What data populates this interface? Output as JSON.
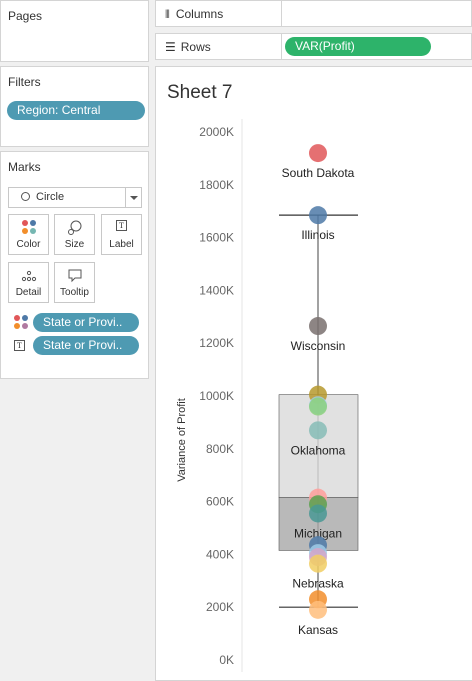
{
  "pages": {
    "title": "Pages"
  },
  "filters": {
    "title": "Filters",
    "pills": [
      "Region: Central"
    ]
  },
  "marks": {
    "title": "Marks",
    "mark_type": "Circle",
    "buttons": {
      "color": "Color",
      "size": "Size",
      "label": "Label",
      "detail": "Detail",
      "tooltip": "Tooltip"
    },
    "fields": {
      "color_field": "State or Provi..",
      "label_field": "State or Provi.."
    }
  },
  "shelves": {
    "columns_label": "Columns",
    "rows_label": "Rows",
    "rows_pill": "VAR(Profit)"
  },
  "sheet": {
    "title": "Sheet 7"
  },
  "chart_data": {
    "type": "scatter",
    "ylabel": "Variance of Profit",
    "ylim": [
      0,
      2000000
    ],
    "ytick_values": [
      0,
      200000,
      400000,
      600000,
      800000,
      1000000,
      1200000,
      1400000,
      1600000,
      1800000,
      2000000
    ],
    "ytick_labels": [
      "0K",
      "200K",
      "400K",
      "600K",
      "800K",
      "1000K",
      "1200K",
      "1400K",
      "1600K",
      "1800K",
      "2000K"
    ],
    "points": [
      {
        "label": "South Dakota",
        "y": 1920000,
        "color": "#e15759",
        "show_label": true
      },
      {
        "label": "Illinois",
        "y": 1685000,
        "color": "#4e79a7",
        "show_label": true
      },
      {
        "label": "Wisconsin",
        "y": 1265000,
        "color": "#79706e",
        "show_label": true
      },
      {
        "label": "",
        "y": 1005000,
        "color": "#b6992d",
        "show_label": false
      },
      {
        "label": "",
        "y": 965000,
        "color": "#a0cbe8",
        "show_label": false
      },
      {
        "label": "",
        "y": 960000,
        "color": "#8cd17d",
        "show_label": false
      },
      {
        "label": "Oklahoma",
        "y": 870000,
        "color": "#86bcb6",
        "show_label": true
      },
      {
        "label": "",
        "y": 615000,
        "color": "#ff9d9a",
        "show_label": false
      },
      {
        "label": "",
        "y": 590000,
        "color": "#59a14f",
        "show_label": false
      },
      {
        "label": "Michigan",
        "y": 555000,
        "color": "#499894",
        "show_label": true
      },
      {
        "label": "",
        "y": 435000,
        "color": "#4e79a7",
        "show_label": false
      },
      {
        "label": "",
        "y": 405000,
        "color": "#a0cbe8",
        "show_label": false
      },
      {
        "label": "",
        "y": 390000,
        "color": "#d4a6c8",
        "show_label": false
      },
      {
        "label": "Nebraska",
        "y": 365000,
        "color": "#f1ce63",
        "show_label": true
      },
      {
        "label": "",
        "y": 230000,
        "color": "#f28e2b",
        "show_label": false
      },
      {
        "label": "Kansas",
        "y": 190000,
        "color": "#ffbe7d",
        "show_label": true
      }
    ],
    "boxplot": {
      "whisker_low": 200000,
      "q1": 415000,
      "median": 615000,
      "q3": 1005000,
      "whisker_high": 1685000
    },
    "grid": false,
    "legend": "none"
  }
}
